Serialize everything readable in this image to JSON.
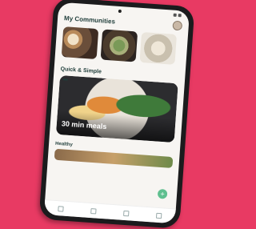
{
  "header": {
    "title": "My Communities"
  },
  "communities": [
    {
      "caption": ""
    },
    {
      "caption": ""
    },
    {
      "caption": ""
    }
  ],
  "section": {
    "subtitle": "",
    "title": "Quick & Simple"
  },
  "hero": {
    "title": "30 min meals"
  },
  "healthy": {
    "title": "Healthy"
  },
  "colors": {
    "background": "#e83a63",
    "accent": "#1f3d3a",
    "fab": "#5fbf8f"
  }
}
